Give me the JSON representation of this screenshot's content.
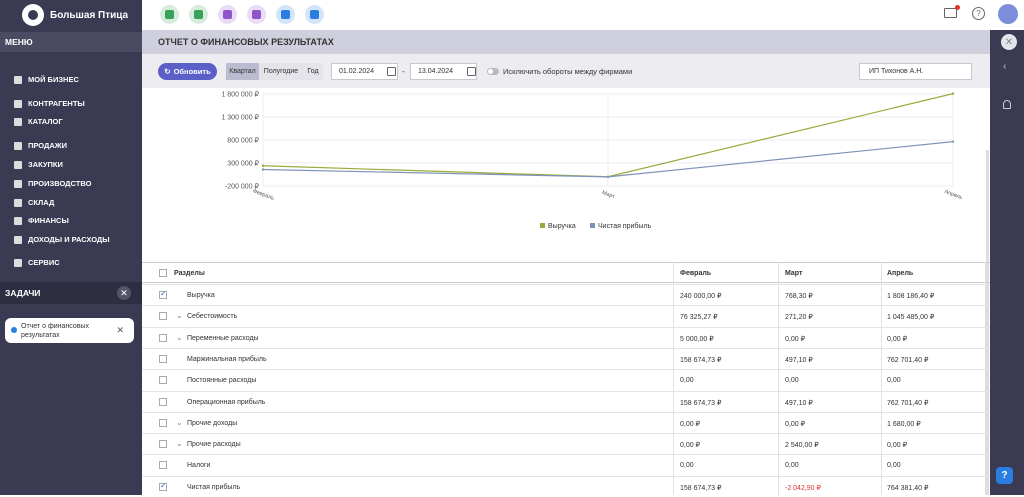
{
  "brand": {
    "name": "Большая Птица"
  },
  "apps": [
    {
      "icon": "cashier-icon",
      "color": "#3aa15a"
    },
    {
      "icon": "desk-icon",
      "color": "#3aa15a"
    },
    {
      "icon": "phone-icon",
      "color": "#8e56c8"
    },
    {
      "icon": "document-icon",
      "color": "#8e56c8"
    },
    {
      "icon": "binoculars-icon",
      "color": "#2a7de1"
    },
    {
      "icon": "files-icon",
      "color": "#2a7de1"
    }
  ],
  "sidebar": {
    "menu_label": "МЕНЮ",
    "items": [
      {
        "label": "МОЙ БИЗНЕС",
        "icon": "star-icon"
      },
      {
        "label": "КОНТРАГЕНТЫ",
        "icon": "building-icon"
      },
      {
        "label": "КАТАЛОГ",
        "icon": "catalog-icon"
      },
      {
        "label": "ПРОДАЖИ",
        "icon": "sales-icon"
      },
      {
        "label": "ЗАКУПКИ",
        "icon": "truck-icon"
      },
      {
        "label": "ПРОИЗВОДСТВО",
        "icon": "factory-icon"
      },
      {
        "label": "СКЛАД",
        "icon": "warehouse-icon"
      },
      {
        "label": "ФИНАНСЫ",
        "icon": "bank-icon"
      },
      {
        "label": "ДОХОДЫ И РАСХОДЫ",
        "icon": "ledger-icon"
      },
      {
        "label": "СЕРВИС",
        "icon": "service-icon"
      }
    ],
    "tasks_label": "ЗАДАЧИ",
    "task_card": {
      "line1": "Отчет о финансовых",
      "line2": "результатах"
    }
  },
  "page": {
    "title": "ОТЧЕТ О ФИНАНСОВЫХ РЕЗУЛЬТАТАХ"
  },
  "toolbar": {
    "refresh_label": "Обновить",
    "period_tabs": [
      "Квартал",
      "Полугодие",
      "Год"
    ],
    "date_from": "01.02.2024",
    "date_sep": "-",
    "date_to": "13.04.2024",
    "exclude_label": "Исключить обороты между фирмами",
    "firm": "ИП Тихонов А.Н."
  },
  "chart_data": {
    "type": "line",
    "categories": [
      "Февраль",
      "Март",
      "Апрель"
    ],
    "series": [
      {
        "name": "Выручка",
        "color": "#9aaa3a",
        "values": [
          240000,
          768.3,
          1808186.4
        ]
      },
      {
        "name": "Чистая прибыль",
        "color": "#7e93b8",
        "values": [
          158674.73,
          -2042.9,
          764381.4
        ]
      }
    ],
    "yticks": [
      "1 800 000 ₽",
      "1 300 000 ₽",
      "800 000 ₽",
      "300 000 ₽",
      "-200 000 ₽"
    ],
    "ytick_values": [
      1800000,
      1300000,
      800000,
      300000,
      -200000
    ],
    "ylim": [
      -200000,
      1800000
    ],
    "legend": "bottom-center"
  },
  "table": {
    "headers": [
      "Разделы",
      "Февраль",
      "Март",
      "Апрель"
    ],
    "rows": [
      {
        "name": "Выручка",
        "checked": true,
        "chevron": false,
        "v": [
          "240 000,00 ₽",
          "768,30 ₽",
          "1 808 186,40 ₽"
        ]
      },
      {
        "name": "Себестоимость",
        "checked": false,
        "chevron": true,
        "v": [
          "76 325,27 ₽",
          "271,20 ₽",
          "1 045 485,00 ₽"
        ]
      },
      {
        "name": "Переменные расходы",
        "checked": false,
        "chevron": true,
        "v": [
          "5 000,00 ₽",
          "0,00 ₽",
          "0,00 ₽"
        ]
      },
      {
        "name": "Маржинальная прибыль",
        "checked": false,
        "chevron": false,
        "v": [
          "158 674,73 ₽",
          "497,10 ₽",
          "762 701,40 ₽"
        ]
      },
      {
        "name": "Постоянные расходы",
        "checked": false,
        "chevron": false,
        "v": [
          "0,00",
          "0,00",
          "0,00"
        ]
      },
      {
        "name": "Операционная прибыль",
        "checked": false,
        "chevron": false,
        "v": [
          "158 674,73 ₽",
          "497,10 ₽",
          "762 701,40 ₽"
        ]
      },
      {
        "name": "Прочие доходы",
        "checked": false,
        "chevron": true,
        "v": [
          "0,00 ₽",
          "0,00 ₽",
          "1 680,00 ₽"
        ]
      },
      {
        "name": "Прочие расходы",
        "checked": false,
        "chevron": true,
        "v": [
          "0,00 ₽",
          "2 540,00 ₽",
          "0,00 ₽"
        ]
      },
      {
        "name": "Налоги",
        "checked": false,
        "chevron": false,
        "v": [
          "0,00",
          "0,00",
          "0,00"
        ]
      },
      {
        "name": "Чистая прибыль",
        "checked": true,
        "chevron": false,
        "v": [
          "158 674,73 ₽",
          "-2 042,90 ₽",
          "764 381,40 ₽"
        ],
        "negative_index": 1
      }
    ]
  }
}
